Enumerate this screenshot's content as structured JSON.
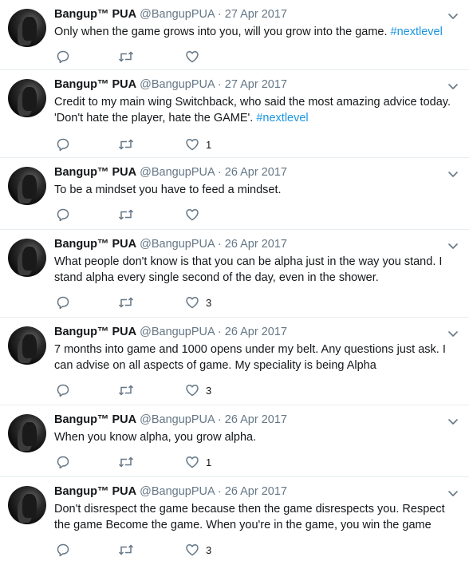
{
  "tweets": [
    {
      "name": "Bangup™ PUA",
      "handle": "@BangupPUA",
      "separator": "·",
      "date": "27 Apr 2017",
      "text": "Only when the game grows into you, will you grow into the game.",
      "hashtag": "#nextlevel",
      "likes": ""
    },
    {
      "name": "Bangup™ PUA",
      "handle": "@BangupPUA",
      "separator": "·",
      "date": "27 Apr 2017",
      "text": "Credit to my main wing Switchback, who said the most amazing advice today. 'Don't hate the player, hate the GAME'.",
      "hashtag": "#nextlevel",
      "likes": "1"
    },
    {
      "name": "Bangup™ PUA",
      "handle": "@BangupPUA",
      "separator": "·",
      "date": "26 Apr 2017",
      "text": "To be a mindset you have to feed a mindset.",
      "hashtag": "",
      "likes": ""
    },
    {
      "name": "Bangup™ PUA",
      "handle": "@BangupPUA",
      "separator": "·",
      "date": "26 Apr 2017",
      "text": "What people don't know is that you can be alpha just in the way you stand. I stand alpha every single second of the day, even in the shower.",
      "hashtag": "",
      "likes": "3"
    },
    {
      "name": "Bangup™ PUA",
      "handle": "@BangupPUA",
      "separator": "·",
      "date": "26 Apr 2017",
      "text": "7 months into game and 1000 opens under my belt. Any questions just ask. I can advise on all aspects of game. My speciality is being Alpha",
      "hashtag": "",
      "likes": "3"
    },
    {
      "name": "Bangup™ PUA",
      "handle": "@BangupPUA",
      "separator": "·",
      "date": "26 Apr 2017",
      "text": "When you know alpha, you grow alpha.",
      "hashtag": "",
      "likes": "1"
    },
    {
      "name": "Bangup™ PUA",
      "handle": "@BangupPUA",
      "separator": "·",
      "date": "26 Apr 2017",
      "text": "Don't disrespect the game because then the game disrespects you. Respect the game Become the game. When you're in the game, you win the game",
      "hashtag": "",
      "likes": "3"
    }
  ],
  "icons": {
    "reply": "reply-icon",
    "retweet": "retweet-icon",
    "like": "heart-icon",
    "menu": "chevron-down-icon"
  },
  "colors": {
    "hashtag": "#1b95e0",
    "secondary_text": "#657786",
    "divider": "#e6ecf0"
  }
}
